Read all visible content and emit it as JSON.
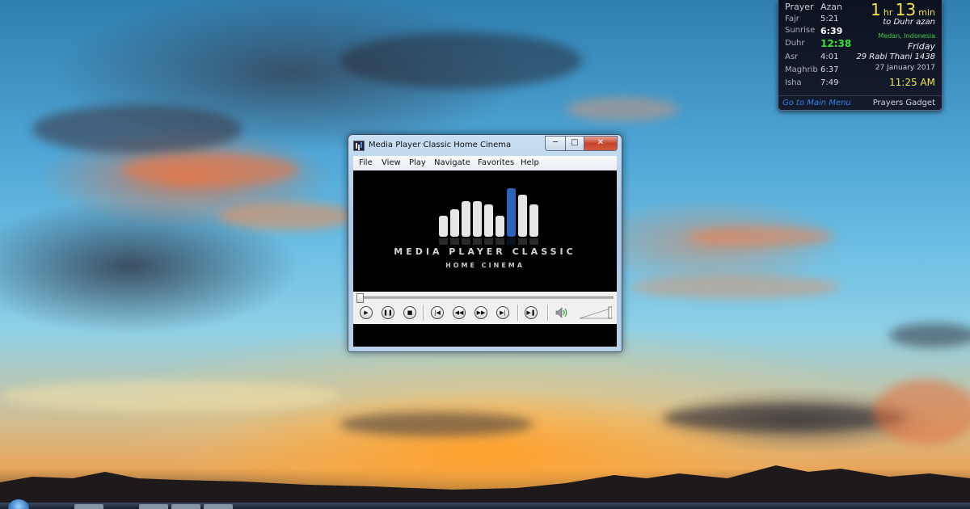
{
  "gadget": {
    "header": {
      "name": "Prayer",
      "time": "Azan"
    },
    "prayers": [
      {
        "name": "Fajr",
        "time": "5:21",
        "style": "normal"
      },
      {
        "name": "Sunrise",
        "time": "6:39",
        "style": "bold"
      },
      {
        "name": "Duhr",
        "time": "12:38",
        "style": "active"
      },
      {
        "name": "Asr",
        "time": "4:01",
        "style": "normal"
      },
      {
        "name": "Maghrib",
        "time": "6:37",
        "style": "normal"
      },
      {
        "name": "Isha",
        "time": "7:49",
        "style": "normal"
      }
    ],
    "countdown": {
      "hours": "1",
      "hours_unit": "hr",
      "minutes": "13",
      "minutes_unit": "min"
    },
    "to_azan": "to Duhr azan",
    "city": "Medan, Indonesia",
    "weekday": "Friday",
    "hijri_date": "29 Rabi Thani 1438",
    "gregorian_date": "27 January 2017",
    "clock": "11:25 AM",
    "main_menu_link": "Go to Main Menu",
    "gadget_name": "Prayers Gadget",
    "colors": {
      "active": "#39e03a",
      "accent": "#f3e14a",
      "link": "#2f7ee8"
    }
  },
  "window": {
    "title": "Media Player Classic Home Cinema",
    "caption_buttons": {
      "minimize": "─",
      "maximize": "□",
      "close": "✕"
    },
    "menu": [
      "File",
      "View",
      "Play",
      "Navigate",
      "Favorites",
      "Help"
    ],
    "logo": {
      "title": "MEDIA PLAYER CLASSIC",
      "subtitle": "HOME CINEMA"
    },
    "seek_position": 0,
    "volume_level": 1.0,
    "controls": [
      {
        "name": "play-button",
        "glyph": "▶"
      },
      {
        "name": "pause-button",
        "glyph": "❚❚"
      },
      {
        "name": "stop-button",
        "glyph": "■"
      },
      {
        "name": "previous-button",
        "glyph": "|◀"
      },
      {
        "name": "rewind-button",
        "glyph": "◀◀"
      },
      {
        "name": "forward-button",
        "glyph": "▶▶"
      },
      {
        "name": "next-button",
        "glyph": "▶|"
      },
      {
        "name": "frame-step-button",
        "glyph": "▶❚"
      }
    ],
    "icons": {
      "volume": "speaker-icon"
    }
  }
}
